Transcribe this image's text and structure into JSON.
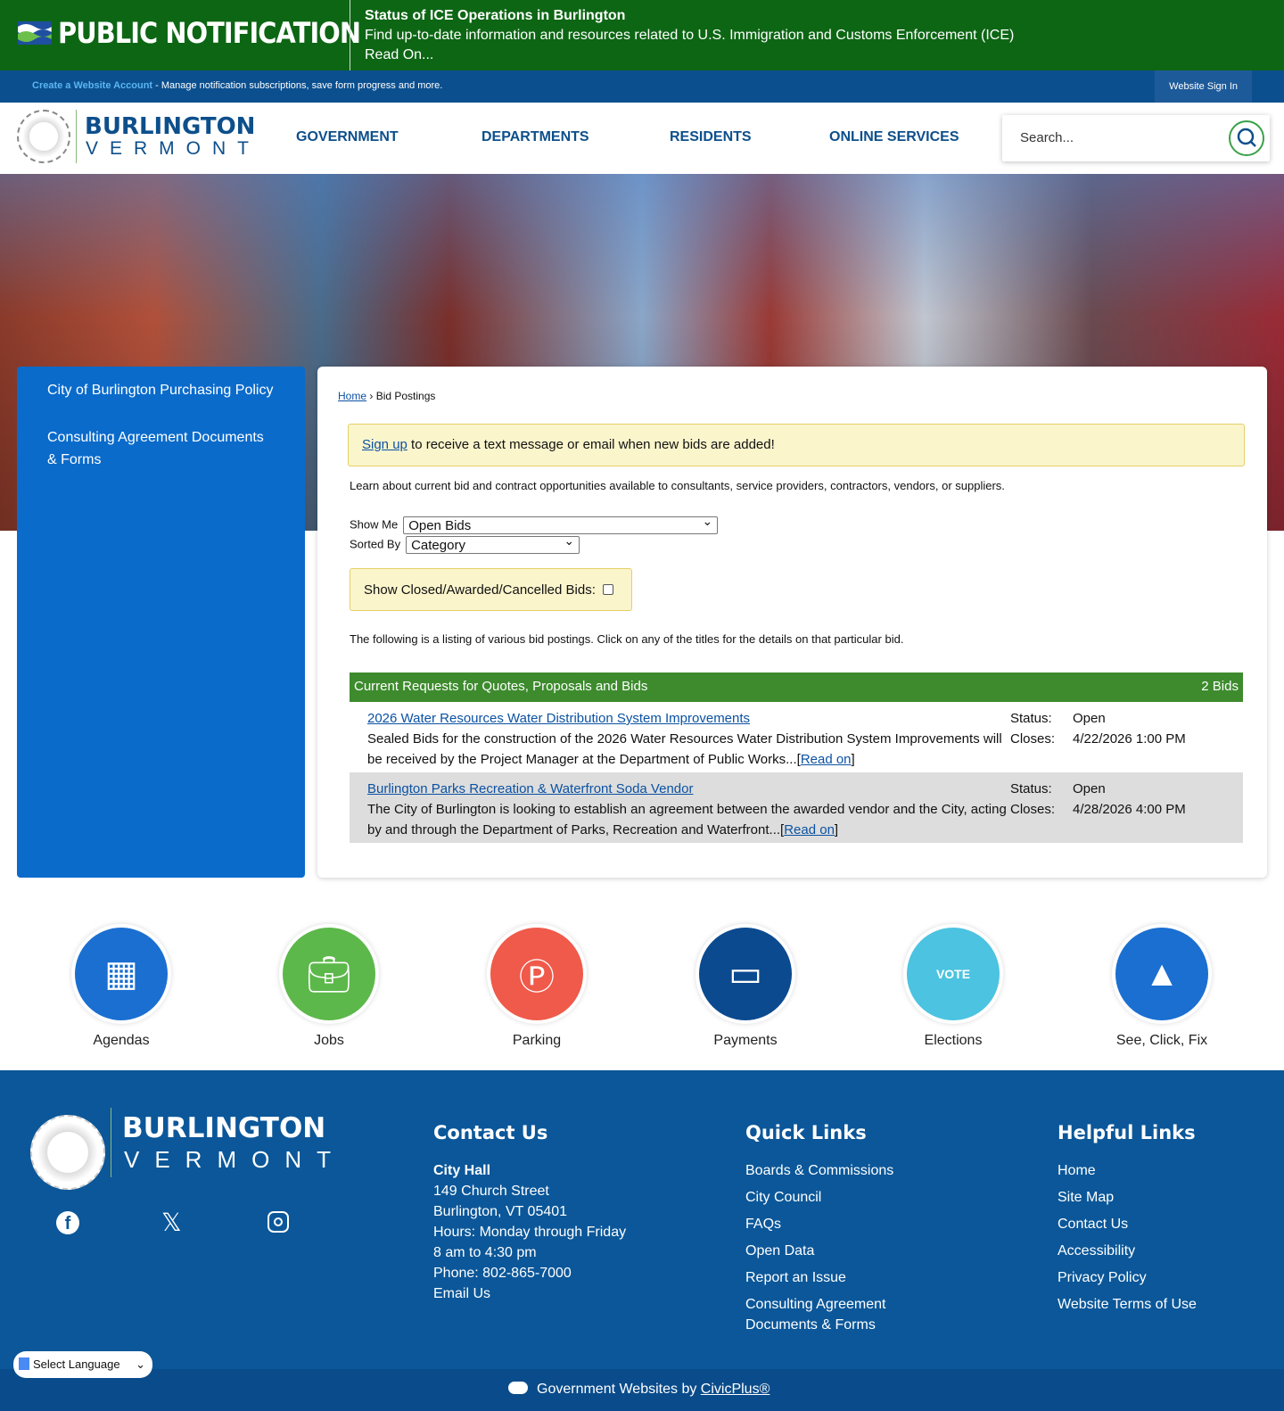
{
  "alert": {
    "brand": "PUBLIC NOTIFICATION",
    "title": "Status of ICE Operations in Burlington",
    "text": "Find up-to-date information and resources related to U.S. Immigration and Customs Enforcement (ICE)",
    "link": "Read On..."
  },
  "account": {
    "link": "Create a Website Account",
    "text": " - Manage notification subscriptions, save form progress and more.",
    "signin": "Website Sign In"
  },
  "logo": {
    "line1": "BURLINGTON",
    "line2": "VERMONT"
  },
  "nav": [
    "GOVERNMENT",
    "DEPARTMENTS",
    "RESIDENTS",
    "ONLINE SERVICES"
  ],
  "search": {
    "placeholder": "Search..."
  },
  "sidebar": [
    "City of Burlington Purchasing Policy",
    "Consulting Agreement Documents & Forms"
  ],
  "breadcrumb": {
    "home": "Home",
    "sep": " › ",
    "current": "Bid Postings"
  },
  "notice": {
    "link": "Sign up",
    "text": " to receive a text message or email when new bids are added!"
  },
  "intro": "Learn about current bid and contract opportunities available to consultants, service providers, contractors, vendors, or suppliers.",
  "filters": {
    "show_label": "Show Me",
    "show_value": "Open Bids",
    "sort_label": "Sorted By",
    "sort_value": "Category",
    "closed_label": "Show Closed/Awarded/Cancelled Bids:"
  },
  "listing_text": "The following is a listing of various bid postings. Click on any of the titles for the details on that particular bid.",
  "table": {
    "header": "Current Requests for Quotes, Proposals and Bids",
    "count": "2 Bids",
    "status_label": "Status:",
    "closes_label": "Closes:",
    "read_on": "Read on",
    "bids": [
      {
        "title": "2026 Water Resources Water Distribution System Improvements",
        "desc": "Sealed Bids for the construction of the 2026 Water Resources Water Distribution System Improvements will be received by the Project Manager at the Department of Public Works...",
        "status": "Open",
        "closes": "4/22/2026 1:00 PM"
      },
      {
        "title": "Burlington Parks Recreation & Waterfront Soda Vendor",
        "desc": "The City of Burlington is looking to establish an agreement between the awarded vendor and the City, acting by and through the Department of Parks, Recreation and Waterfront...",
        "status": "Open",
        "closes": "4/28/2026 4:00 PM"
      }
    ]
  },
  "tiles": [
    {
      "label": "Agendas",
      "color": "#1a6fd1"
    },
    {
      "label": "Jobs",
      "color": "#5cb84a"
    },
    {
      "label": "Parking",
      "color": "#ef5a4a"
    },
    {
      "label": "Payments",
      "color": "#0b4a8f"
    },
    {
      "label": "Elections",
      "color": "#4cc3e0"
    },
    {
      "label": "See, Click, Fix",
      "color": "#1a6fd1"
    }
  ],
  "footer": {
    "contact_title": "Contact Us",
    "contact": [
      "City Hall",
      "149 Church Street",
      "Burlington, VT 05401",
      "Hours: Monday through Friday",
      "8 am to 4:30 pm",
      "Phone: 802-865-7000",
      "Email Us"
    ],
    "quick_title": "Quick Links",
    "quick": [
      "Boards & Commissions",
      "City Council",
      "FAQs",
      "Open Data",
      "Report an Issue",
      "Consulting Agreement Documents & Forms"
    ],
    "helpful_title": "Helpful Links",
    "helpful": [
      "Home",
      "Site Map",
      "Contact Us",
      "Accessibility",
      "Privacy Policy",
      "Website Terms of Use"
    ]
  },
  "bottom": {
    "text": "Government Websites by ",
    "link": "CivicPlus®"
  },
  "language": "Select Language"
}
